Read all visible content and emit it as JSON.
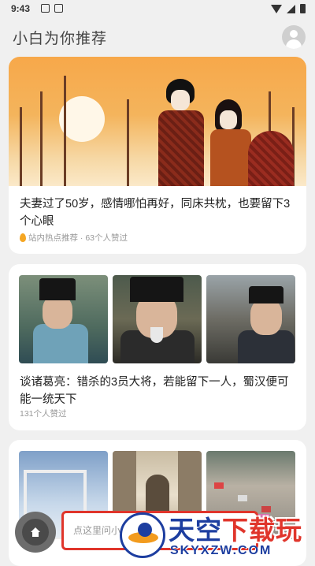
{
  "status_bar": {
    "time": "9:43"
  },
  "header": {
    "title": "小白为你推荐"
  },
  "feed": [
    {
      "title": "夫妻过了50岁，感情哪怕再好，同床共枕，也要留下3个心眼",
      "meta": "站内热点推荐 · 63个人赞过"
    },
    {
      "title": "谈诸葛亮：错杀的3员大将，若能留下一人，蜀汉便可能一统天下",
      "meta": "131个人赞过"
    }
  ],
  "bottom_bar": {
    "ask_placeholder": "点这里问小"
  },
  "watermark": {
    "line1_a": "天空",
    "line1_b": "下载玩",
    "line2": "SKYXZW.COM"
  },
  "icons": [
    "avatar-icon",
    "home-icon",
    "flame-icon",
    "wifi-icon",
    "signal-icon",
    "battery-icon"
  ],
  "colors": {
    "accent_red": "#e0352b",
    "watermark_blue": "#1d3ea0",
    "watermark_orange": "#f29b1e"
  }
}
